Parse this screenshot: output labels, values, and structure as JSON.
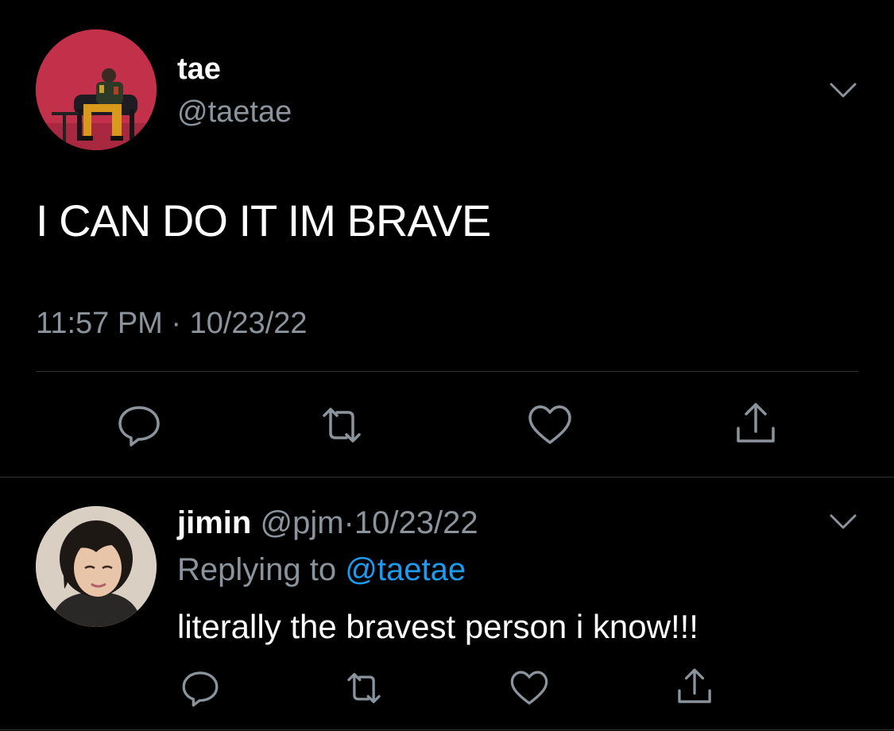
{
  "main_tweet": {
    "display_name": "tae",
    "handle": "@taetae",
    "text": "I CAN DO IT IM BRAVE",
    "timestamp": "11:57 PM · 10/23/22",
    "avatar": "avatar-photo-man-seated-on-red-chair",
    "actions": [
      "reply-icon",
      "retweet-icon",
      "like-icon",
      "share-icon"
    ]
  },
  "reply_tweet": {
    "display_name": "jimin",
    "handle": "@pjm",
    "separator": "·",
    "date": "10/23/22",
    "replying_label": "Replying to",
    "replying_target": "@taetae",
    "text": "literally the bravest person i know!!!",
    "avatar": "avatar-photo-person-dark-hair",
    "actions": [
      "reply-icon",
      "retweet-icon",
      "like-icon",
      "share-icon"
    ]
  },
  "colors": {
    "background": "#000000",
    "primary_text": "#ffffff",
    "secondary_text": "#8b949c",
    "link": "#1d9bf0",
    "divider": "#2f3336",
    "main_avatar_bg": "#c2304a"
  }
}
